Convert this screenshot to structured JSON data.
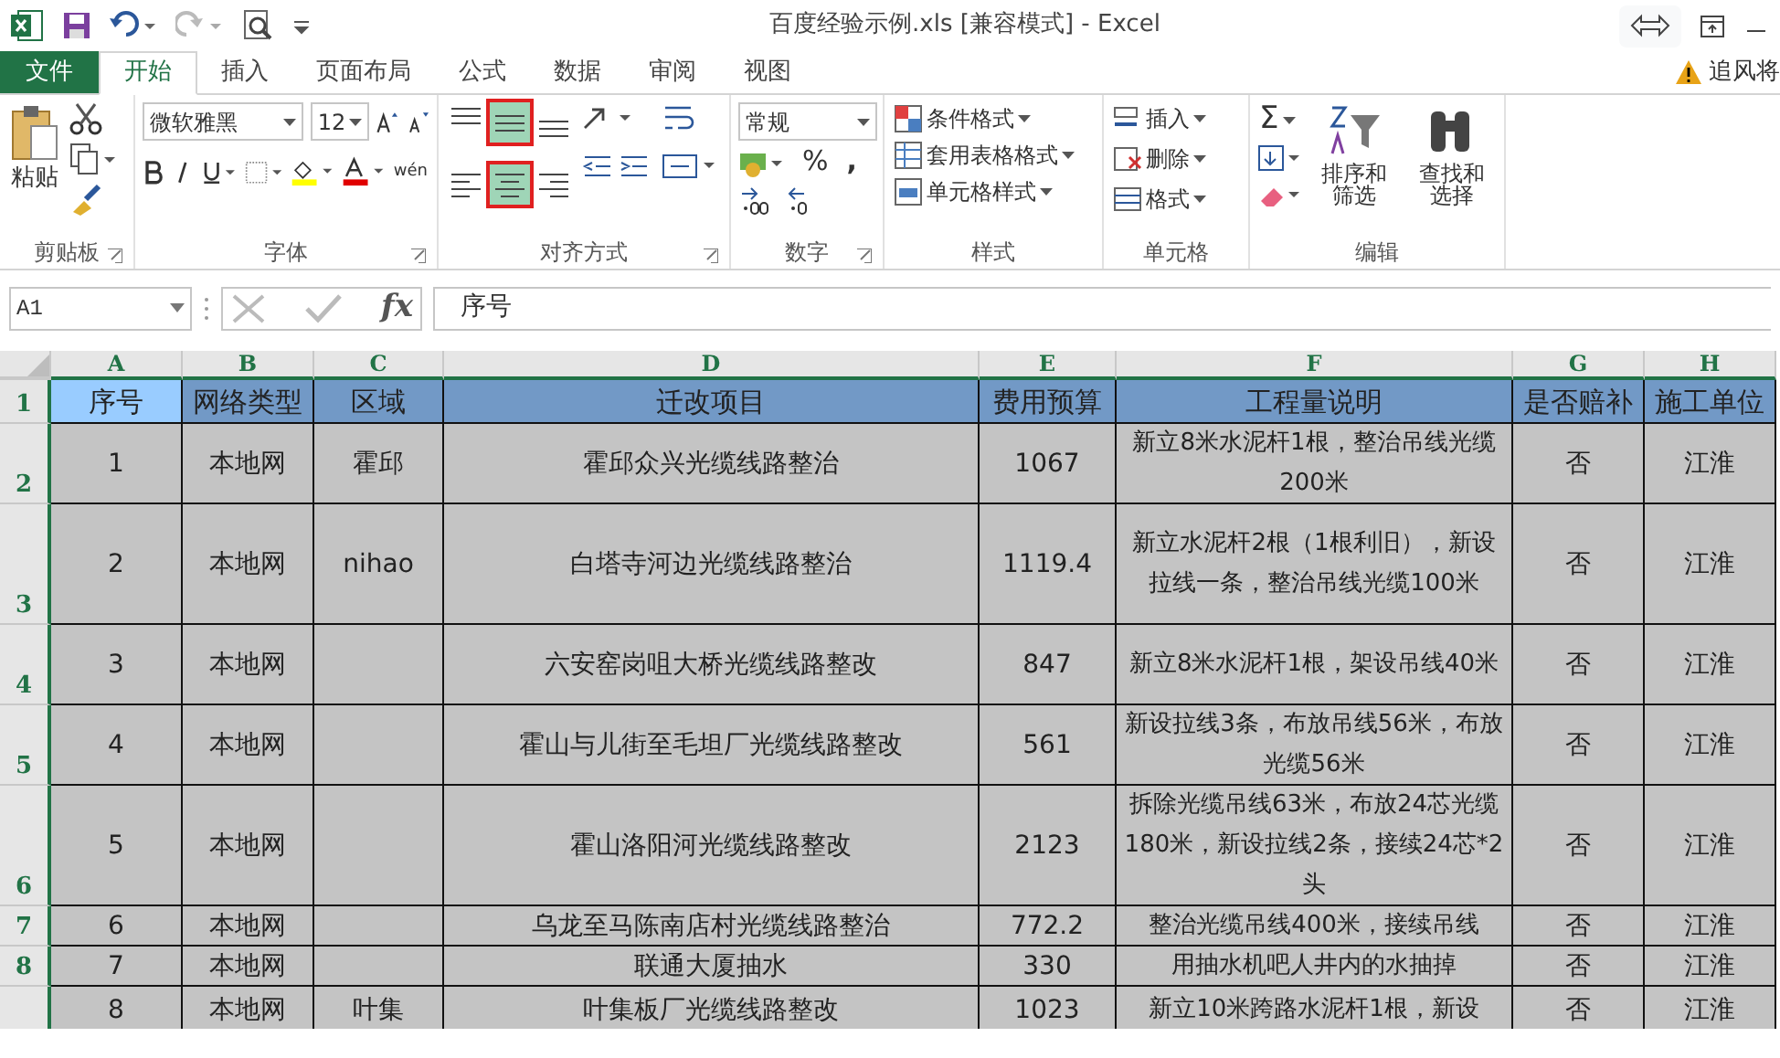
{
  "window": {
    "title": "百度经验示例.xls  [兼容模式] - Excel",
    "user": "追风将"
  },
  "tabs": [
    {
      "label": "文件",
      "kind": "file",
      "selected": false
    },
    {
      "label": "开始",
      "kind": "tab",
      "selected": true
    },
    {
      "label": "插入",
      "kind": "tab",
      "selected": false
    },
    {
      "label": "页面布局",
      "kind": "tab",
      "selected": false
    },
    {
      "label": "公式",
      "kind": "tab",
      "selected": false
    },
    {
      "label": "数据",
      "kind": "tab",
      "selected": false
    },
    {
      "label": "审阅",
      "kind": "tab",
      "selected": false
    },
    {
      "label": "视图",
      "kind": "tab",
      "selected": false
    }
  ],
  "ribbon": {
    "clipboard": {
      "label": "剪贴板",
      "paste": "粘贴"
    },
    "font": {
      "label": "字体",
      "font_name": "微软雅黑",
      "font_size": "12",
      "phonetic": "wén"
    },
    "alignment": {
      "label": "对齐方式",
      "buttons": [
        {
          "kind": "top",
          "selected": false
        },
        {
          "kind": "middle",
          "selected": true
        },
        {
          "kind": "bottom",
          "selected": false
        },
        {
          "kind": "left",
          "selected": false
        },
        {
          "kind": "center",
          "selected": true
        },
        {
          "kind": "right",
          "selected": false
        }
      ]
    },
    "number": {
      "label": "数字",
      "format": "常规",
      "percent": "%",
      "comma": ","
    },
    "styles": {
      "label": "样式",
      "items": [
        "条件格式",
        "套用表格格式",
        "单元格样式"
      ]
    },
    "cells": {
      "label": "单元格",
      "items": [
        "插入",
        "删除",
        "格式"
      ]
    },
    "editing": {
      "label": "编辑",
      "sigma": "Σ",
      "sort": "排序和筛选",
      "find": "查找和选择"
    }
  },
  "formula_bar": {
    "name_box": "A1",
    "fx": "fx",
    "formula": "序号"
  },
  "sheet": {
    "columns": [
      "A",
      "B",
      "C",
      "D",
      "E",
      "F",
      "G",
      "H"
    ],
    "rows": [
      {
        "number": "1",
        "kind": "header",
        "cells": [
          "序号",
          "网络类型",
          "区域",
          "迁改项目",
          "费用预算",
          "工程量说明",
          "是否赔补",
          "施工单位"
        ]
      },
      {
        "number": "2",
        "kind": "data",
        "cells": [
          "1",
          "本地网",
          "霍邱",
          "霍邱众兴光缆线路整治",
          "1067",
          "新立8米水泥杆1根，整治吊线光缆200米",
          "否",
          "江淮"
        ]
      },
      {
        "number": "3",
        "kind": "data",
        "cells": [
          "2",
          "本地网",
          "nihao",
          "白塔寺河边光缆线路整治",
          "1119.4",
          "新立水泥杆2根（1根利旧），新设拉线一条，整治吊线光缆100米",
          "否",
          "江淮"
        ]
      },
      {
        "number": "4",
        "kind": "data",
        "cells": [
          "3",
          "本地网",
          "",
          "六安窑岗咀大桥光缆线路整改",
          "847",
          "新立8米水泥杆1根，架设吊线40米",
          "否",
          "江淮"
        ]
      },
      {
        "number": "5",
        "kind": "data",
        "cells": [
          "4",
          "本地网",
          "",
          "霍山与儿街至毛坦厂光缆线路整改",
          "561",
          "新设拉线3条，布放吊线56米，布放光缆56米",
          "否",
          "江淮"
        ]
      },
      {
        "number": "6",
        "kind": "data",
        "cells": [
          "5",
          "本地网",
          "",
          "霍山洛阳河光缆线路整改",
          "2123",
          "拆除光缆吊线63米，布放24芯光缆180米，新设拉线2条，接续24芯*2头",
          "否",
          "江淮"
        ]
      },
      {
        "number": "7",
        "kind": "data",
        "cells": [
          "6",
          "本地网",
          "",
          "乌龙至马陈南店村光缆线路整治",
          "772.2",
          "整治光缆吊线400米，接续吊线",
          "否",
          "江淮"
        ]
      },
      {
        "number": "8",
        "kind": "data",
        "cells": [
          "7",
          "本地网",
          "",
          "联通大厦抽水",
          "330",
          "用抽水机吧人井内的水抽掉",
          "否",
          "江淮"
        ]
      },
      {
        "kind": "data",
        "cells": [
          "8",
          "本地网",
          "叶集",
          "叶集板厂光缆线路整改",
          "1023",
          "新立10米跨路水泥杆1根，新设",
          "否",
          "江淮"
        ]
      }
    ]
  }
}
